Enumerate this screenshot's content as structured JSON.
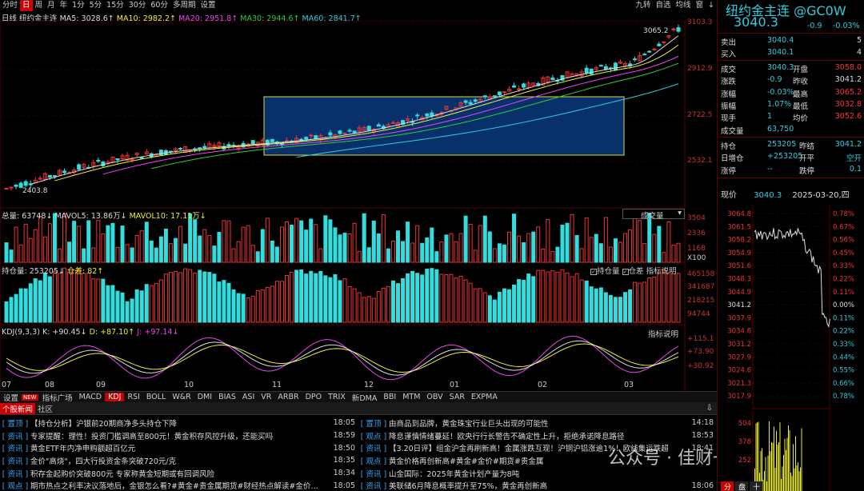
{
  "toolbar": {
    "tabs": [
      "分时",
      "日",
      "周",
      "月",
      "年",
      "1分",
      "5分",
      "15分",
      "30分",
      "60分",
      "多周期",
      "设置"
    ],
    "selected": 1,
    "right": [
      "九转",
      "自选",
      "均线",
      "窗",
      "↓"
    ]
  },
  "ma_line": {
    "period": "日线",
    "name": "纽约金主连",
    "ma5": "MA5: 3028.6↑",
    "ma10": "MA10: 2982.2↑",
    "ma20": "MA20: 2951.8↑",
    "ma30": "MA30: 2944.6↑",
    "ma60": "MA60: 2841.7↑"
  },
  "price_axis": [
    "3103.3",
    "2912.9",
    "2722.5",
    "2532.1"
  ],
  "annotations": {
    "high": "3065.2",
    "low": "2403.8"
  },
  "volume": {
    "total": "总量: 63748↓",
    "mavol5": "MAVOL5: 13.86万↓",
    "mavol10": "MAVOL10: 17.11万↓",
    "selector": "成交量",
    "axis": [
      "3504",
      "2336",
      "1168",
      "X100"
    ]
  },
  "oi": {
    "label": "持仓量: 253205↓",
    "diff": "仓差: 82↑",
    "cb1": "持仓量",
    "cb2": "仓差",
    "explain": "指标说明",
    "axis": [
      "465158",
      "341687",
      "218215",
      "94744"
    ]
  },
  "kdj": {
    "label": "KDJ(9,3,3)",
    "k": "K: +90.45↓",
    "d": "D: +87.10↑",
    "j": "J: +97.14↓",
    "explain": "指标说明",
    "axis": [
      "+115.1",
      "+73.90",
      "+30.92"
    ]
  },
  "months": [
    "07",
    "08",
    "09",
    "10",
    "11",
    "12",
    "01",
    "02",
    "03"
  ],
  "indicator_tabs": [
    "设置",
    "NEW",
    "指标广场",
    "MACD",
    "KDJ",
    "RSI",
    "BOLL",
    "W&R",
    "DMI",
    "BIAS",
    "ASI",
    "VR",
    "ARBR",
    "DPO",
    "TRIX",
    "新DMA",
    "BBI",
    "MTM",
    "OBV",
    "SAR",
    "EXPMA"
  ],
  "indicator_selected": "KDJ",
  "news_tabs": [
    "个股新闻",
    "社区"
  ],
  "news_left": [
    {
      "cat": "置顶",
      "title": "【持仓分析】沪银前20期商净多头持仓下降",
      "time": "18:05"
    },
    {
      "cat": "资讯",
      "title": "专家提醒：理性！投资门槛调高至800元！黄金积存风控升级，还能买吗",
      "time": "18:59"
    },
    {
      "cat": "资讯",
      "title": "黄金ETF年内净申购额超百亿元",
      "time": "18:50"
    },
    {
      "cat": "资讯",
      "title": "金价\"高烧\"，四大行投资金条突破720元/克",
      "time": "18:35"
    },
    {
      "cat": "资讯",
      "title": "积存金起购价突破800元 专家称黄金短期或有回调风险",
      "time": "18:34"
    },
    {
      "cat": "观点",
      "title": "期市热点之利率决议落地后，金银怎么看?#黄金#贵金属期货#财经热点解读#金价…",
      "time": "18:05"
    }
  ],
  "news_right": [
    {
      "cat": "置顶",
      "title": "由商品到品牌，黄金珠宝行业巨头出现的可能性",
      "time": "14:18"
    },
    {
      "cat": "观点",
      "title": "降息谨慎情绪蔓延！欧央行行长警告不确定性上升，拒绝承诺降息路径",
      "time": "18:53"
    },
    {
      "cat": "资讯",
      "title": "【3.20日评】组金沪金再刷新高！金属涨跌互现！沪铜沪铝涨逾1%！欧线集运跌超",
      "time": "18:41"
    },
    {
      "cat": "观点",
      "title": "黄金价格再创新高#黄金#金价#期货#贵金属",
      "time": ""
    },
    {
      "cat": "资讯",
      "title": "山金国际：2025年黄金计划产量为8吨",
      "time": ""
    },
    {
      "cat": "资讯",
      "title": "美联储6月降息概率提升至75%，黄金再创新高",
      "time": "18:06"
    }
  ],
  "watermark": "公众号 · 佳财一分钟",
  "quote": {
    "title": "纽约金主连 @GC0W",
    "price": "3040.3",
    "change": "-0.9",
    "pct": "-0.03%",
    "sell": {
      "l": "卖出",
      "p": "3040.4",
      "v": "5"
    },
    "buy": {
      "l": "买入",
      "p": "3040.1",
      "v": "4"
    },
    "rows": [
      {
        "l1": "成交",
        "v1": "3040.3",
        "l2": "开盘",
        "v2": "3058.0"
      },
      {
        "l1": "涨跌",
        "v1": "-0.9",
        "l2": "昨收",
        "v2": "3041.2"
      },
      {
        "l1": "涨幅",
        "v1": "-0.03%",
        "l2": "最高",
        "v2": "3065.2"
      },
      {
        "l1": "振幅",
        "v1": "1.07%",
        "l2": "最低",
        "v2": "3032.8"
      },
      {
        "l1": "现手",
        "v1": "1",
        "l2": "均价",
        "v2": "3052.6"
      },
      {
        "l1": "成交量",
        "v1": "63,750",
        "l2": "",
        "v2": ""
      }
    ],
    "rows2": [
      {
        "l1": "持仓",
        "v1": "253205",
        "l2": "昨结",
        "v2": "3041.2"
      },
      {
        "l1": "日增仓",
        "v1": "+253205",
        "l2": "开平",
        "v2": "空开"
      },
      {
        "l1": "涨停",
        "v1": "--",
        "l2": "跌停",
        "v2": "0.1"
      }
    ],
    "now_label": "现价",
    "now_price": "3040.3",
    "date": "2025-03-20,四",
    "mini_left": [
      "3064.8",
      "3061.5",
      "3058.2",
      "3054.9",
      "3051.6",
      "3048.3",
      "3044.9",
      "3041.2",
      "3037.9",
      "3034.6",
      "3031.2",
      "3027.9",
      "3024.6",
      "3021.3",
      "3017.9"
    ],
    "mini_right": [
      "0.78%",
      "0.67%",
      "0.56%",
      "0.45%",
      "0.33%",
      "0.22%",
      "0.11%",
      "0.00%",
      "0.11%",
      "0.22%",
      "0.33%",
      "0.44%",
      "0.55%",
      "0.66%",
      "0.78%"
    ],
    "mini_vol": [
      "504",
      "378",
      "252"
    ],
    "bottom_tabs": [
      "分",
      "盘",
      "十"
    ]
  }
}
